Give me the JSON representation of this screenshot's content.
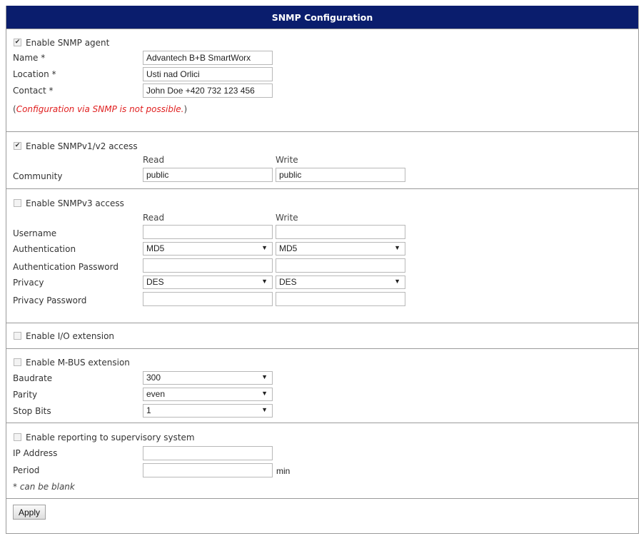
{
  "title": "SNMP Configuration",
  "agent": {
    "enable_label": "Enable SNMP agent",
    "enabled": true,
    "name_label": "Name *",
    "name_value": "Advantech B+B SmartWorx",
    "location_label": "Location *",
    "location_value": "Usti nad Orlici",
    "contact_label": "Contact *",
    "contact_value": "John Doe +420 732 123 456",
    "note_open": "(",
    "note_text": "Configuration via SNMP is not possible.",
    "note_close": ")"
  },
  "v12": {
    "enable_label": "Enable SNMPv1/v2 access",
    "enabled": true,
    "read_header": "Read",
    "write_header": "Write",
    "community_label": "Community",
    "community_read": "public",
    "community_write": "public"
  },
  "v3": {
    "enable_label": "Enable SNMPv3 access",
    "enabled": false,
    "read_header": "Read",
    "write_header": "Write",
    "username_label": "Username",
    "username_read": "",
    "username_write": "",
    "auth_label": "Authentication",
    "auth_read": "MD5",
    "auth_write": "MD5",
    "auth_pw_label": "Authentication Password",
    "privacy_label": "Privacy",
    "privacy_read": "DES",
    "privacy_write": "DES",
    "privacy_pw_label": "Privacy Password"
  },
  "io": {
    "enable_label": "Enable I/O extension",
    "enabled": false
  },
  "mbus": {
    "enable_label": "Enable M-BUS extension",
    "enabled": false,
    "baudrate_label": "Baudrate",
    "baudrate_value": "300",
    "parity_label": "Parity",
    "parity_value": "even",
    "stopbits_label": "Stop Bits",
    "stopbits_value": "1"
  },
  "report": {
    "enable_label": "Enable reporting to supervisory system",
    "enabled": false,
    "ip_label": "IP Address",
    "ip_value": "",
    "period_label": "Period",
    "period_value": "",
    "period_unit": "min",
    "blank_note": "* can be blank"
  },
  "apply_label": "Apply"
}
